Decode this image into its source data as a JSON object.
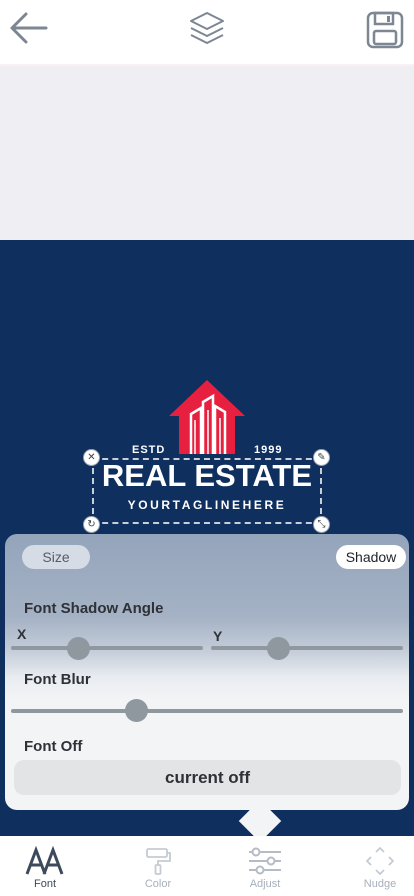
{
  "topbar": {
    "back_icon": "arrow-left-icon",
    "layers_icon": "layers-icon",
    "save_icon": "floppy-disk-icon"
  },
  "design": {
    "estd": "ESTD",
    "year": "1999",
    "headline": "REAL ESTATE",
    "tagline": "YOURTAGLINEHERE",
    "background_color": "#0f2f5e",
    "accent_color": "#e8203f"
  },
  "panel": {
    "size_label": "Size",
    "shadow_label": "Shadow",
    "shadow_angle_label": "Font Shadow Angle",
    "x_label": "X",
    "y_label": "Y",
    "blur_label": "Font Blur",
    "off_label": "Font Off",
    "current_off_label": "current off",
    "x_value": 0.35,
    "y_value": 0.35,
    "blur_value": 0.32
  },
  "tabs": [
    {
      "label": "Font",
      "icon": "font-aa-icon",
      "active": true
    },
    {
      "label": "Color",
      "icon": "paint-roller-icon",
      "active": false
    },
    {
      "label": "Adjust",
      "icon": "sliders-icon",
      "active": false
    },
    {
      "label": "Nudge",
      "icon": "move-arrows-icon",
      "active": false
    }
  ]
}
